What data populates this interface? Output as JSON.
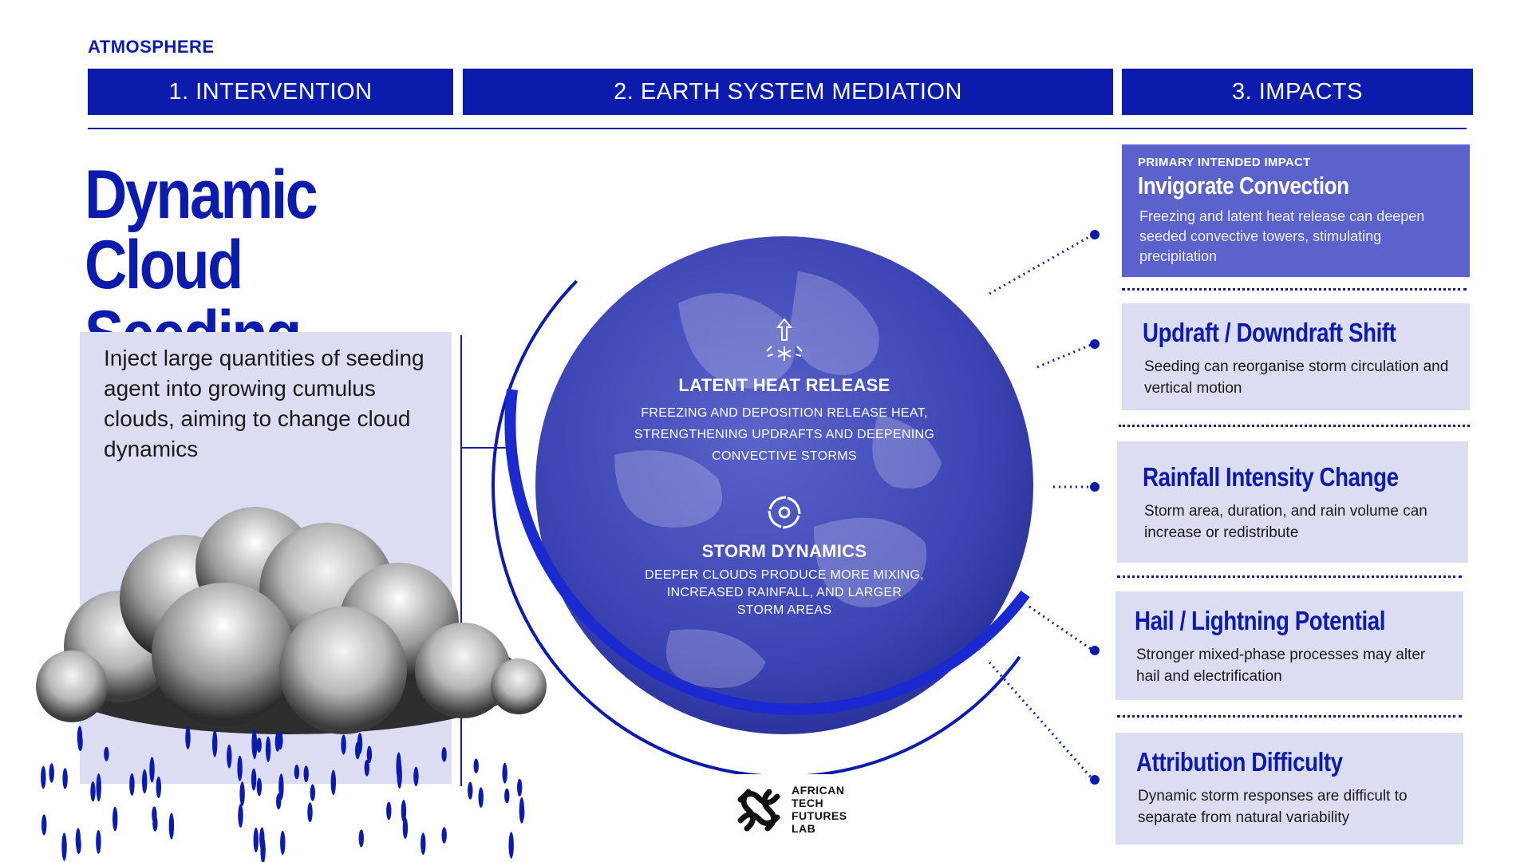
{
  "section_tag": "ATMOSPHERE",
  "columns": [
    {
      "label": "1. INTERVENTION"
    },
    {
      "label": "2. EARTH SYSTEM MEDIATION"
    },
    {
      "label": "3. IMPACTS"
    }
  ],
  "title_line1": "Dynamic Cloud",
  "title_line2": "Seeding",
  "description": "Inject large quantities of seeding agent into growing cumulus clouds, aiming to change cloud dynamics",
  "mediation": {
    "latent": {
      "title": "LATENT HEAT RELEASE",
      "line1": "FREEZING AND DEPOSITION RELEASE HEAT,",
      "line2": "STRENGTHENING UPDRAFTS AND DEEPENING",
      "line3": "CONVECTIVE STORMS"
    },
    "storm": {
      "title": "STORM DYNAMICS",
      "line1": "DEEPER CLOUDS PRODUCE MORE MIXING,",
      "line2": "INCREASED RAINFALL, AND LARGER",
      "line3": "STORM AREAS"
    }
  },
  "impacts": [
    {
      "kicker": "PRIMARY INTENDED IMPACT",
      "title": "Invigorate Convection",
      "body": "Freezing and latent heat release can deepen seeded convective towers, stimulating precipitation"
    },
    {
      "title": "Updraft / Downdraft Shift",
      "body": "Seeding can reorganise storm circulation and vertical motion"
    },
    {
      "title": "Rainfall Intensity Change",
      "body": "Storm area, duration, and rain volume can increase or redistribute"
    },
    {
      "title": "Hail / Lightning Potential",
      "body": "Stronger mixed-phase processes may alter hail and electrification"
    },
    {
      "title": "Attribution Difficulty",
      "body": "Dynamic storm responses are difficult to separate from natural variability"
    }
  ],
  "logo": {
    "line1": "AFRICAN",
    "line2": "TECH",
    "line3": "FUTURES",
    "line4": "LAB"
  },
  "colors": {
    "brand_blue": "#0b1bab",
    "primary_box": "#5b62cc",
    "light_box": "#dcdcf2"
  }
}
